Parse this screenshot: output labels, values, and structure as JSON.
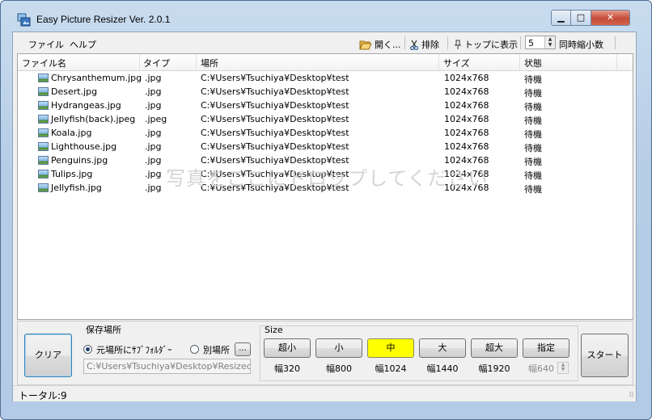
{
  "window": {
    "title": "Easy Picture Resizer Ver. 2.0.1",
    "min_glyph": "▁",
    "max_glyph": "□",
    "close_glyph": "✕"
  },
  "menu": {
    "file": "ファイル",
    "help": "ヘルプ"
  },
  "toolbar": {
    "open": "開く...",
    "exclude": "排除",
    "topmost": "トップに表示",
    "concurrency_value": "5",
    "concurrency_label": "同時縮小数"
  },
  "columns": {
    "name": "ファイル名",
    "type": "タイプ",
    "location": "場所",
    "size": "サイズ",
    "status": "状態"
  },
  "files": [
    {
      "name": "Chrysanthemum.jpg",
      "type": ".jpg",
      "location": "C:¥Users¥Tsuchiya¥Desktop¥test",
      "size": "1024x768",
      "status": "待機"
    },
    {
      "name": "Desert.jpg",
      "type": ".jpg",
      "location": "C:¥Users¥Tsuchiya¥Desktop¥test",
      "size": "1024x768",
      "status": "待機"
    },
    {
      "name": "Hydrangeas.jpg",
      "type": ".jpg",
      "location": "C:¥Users¥Tsuchiya¥Desktop¥test",
      "size": "1024x768",
      "status": "待機"
    },
    {
      "name": "Jellyfish(back).jpeg",
      "type": ".jpeg",
      "location": "C:¥Users¥Tsuchiya¥Desktop¥test",
      "size": "1024x768",
      "status": "待機"
    },
    {
      "name": "Koala.jpg",
      "type": ".jpg",
      "location": "C:¥Users¥Tsuchiya¥Desktop¥test",
      "size": "1024x768",
      "status": "待機"
    },
    {
      "name": "Lighthouse.jpg",
      "type": ".jpg",
      "location": "C:¥Users¥Tsuchiya¥Desktop¥test",
      "size": "1024x768",
      "status": "待機"
    },
    {
      "name": "Penguins.jpg",
      "type": ".jpg",
      "location": "C:¥Users¥Tsuchiya¥Desktop¥test",
      "size": "1024x768",
      "status": "待機"
    },
    {
      "name": "Tulips.jpg",
      "type": ".jpg",
      "location": "C:¥Users¥Tsuchiya¥Desktop¥test",
      "size": "1024x768",
      "status": "待機"
    },
    {
      "name": "Jellyfish.jpg",
      "type": ".jpg",
      "location": "C:¥Users¥Tsuchiya¥Desktop¥test",
      "size": "1024x768",
      "status": "待機"
    }
  ],
  "drop_hint": "写真をここにドロップしてください",
  "bottom": {
    "clear": "クリア",
    "save_location_label": "保存場所",
    "option_subfolder": "元場所にｻﾌﾞﾌｫﾙﾀﾞｰ",
    "option_other": "別場所",
    "browse": "...",
    "save_path": "C:¥Users¥Tsuchiya¥Desktop¥ResizedPi",
    "size_label": "Size",
    "sizes": [
      {
        "label": "超小",
        "width": "幅320"
      },
      {
        "label": "小",
        "width": "幅800"
      },
      {
        "label": "中",
        "width": "幅1024"
      },
      {
        "label": "大",
        "width": "幅1440"
      },
      {
        "label": "超大",
        "width": "幅1920"
      },
      {
        "label": "指定",
        "width": "幅640"
      }
    ],
    "selected_size": "中",
    "start": "スタート"
  },
  "status": {
    "total": "トータル:9"
  },
  "colors": {
    "selected_size": "#ffff00",
    "title_bg": "#c9dcef"
  },
  "icons": [
    "app-icon",
    "folder-open-icon",
    "scissors-icon",
    "pin-icon",
    "image-file-icon",
    "resize-grip-icon"
  ]
}
